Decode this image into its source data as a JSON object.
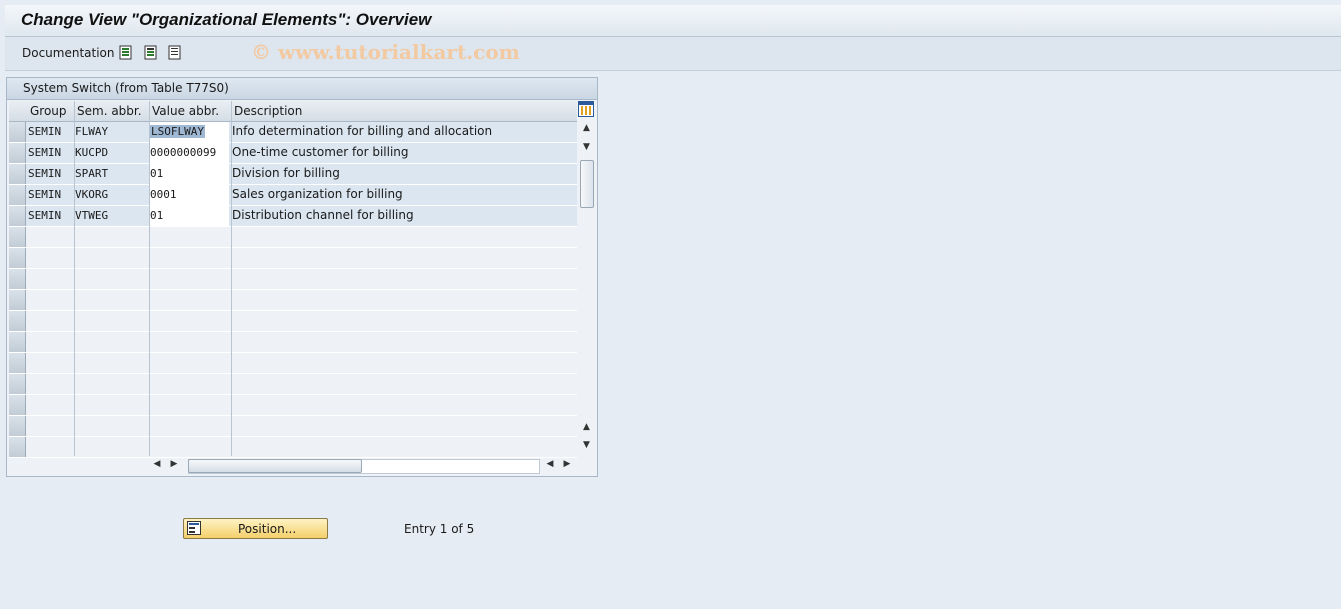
{
  "title": "Change View \"Organizational Elements\": Overview",
  "toolbar": {
    "documentation_label": "Documentation",
    "icons": [
      "select-all-icon",
      "select-block-icon",
      "deselect-all-icon"
    ]
  },
  "watermark": "© www.tutorialkart.com",
  "panel": {
    "title": "System Switch (from Table T77S0)",
    "columns": [
      "Group",
      "Sem. abbr.",
      "Value abbr.",
      "Description"
    ],
    "rows": [
      {
        "group": "SEMIN",
        "sem": "FLWAY",
        "value": "LSOFLWAY",
        "desc": "Info determination for billing and allocation"
      },
      {
        "group": "SEMIN",
        "sem": "KUCPD",
        "value": "0000000099",
        "desc": "One-time customer for billing"
      },
      {
        "group": "SEMIN",
        "sem": "SPART",
        "value": "01",
        "desc": "Division for billing"
      },
      {
        "group": "SEMIN",
        "sem": "VKORG",
        "value": "0001",
        "desc": "Sales organization for billing"
      },
      {
        "group": "SEMIN",
        "sem": "VTWEG",
        "value": "01",
        "desc": "Distribution channel for billing"
      }
    ],
    "empty_rows": 11
  },
  "footer": {
    "position_button": "Position...",
    "entry_text": "Entry 1 of 5"
  },
  "colors": {
    "background": "#e5ecf3",
    "button_accent": "#f3cf6a",
    "selected_value_highlight": "#9fb8d3"
  }
}
